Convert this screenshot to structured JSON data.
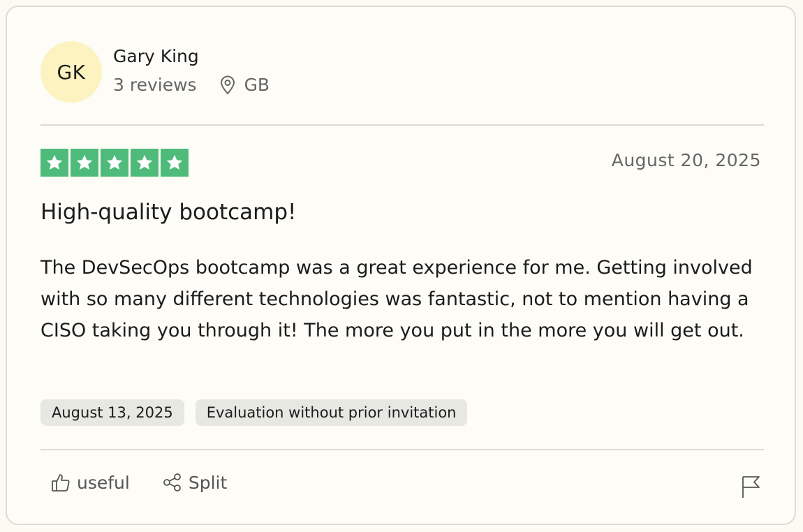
{
  "reviewer": {
    "initials": "GK",
    "name": "Gary King",
    "reviews": "3 reviews",
    "country": "GB"
  },
  "rating": {
    "stars": 5,
    "max": 5,
    "star_color": "#4fbb7b"
  },
  "review": {
    "date": "August 20, 2025",
    "title": "High-quality bootcamp!",
    "body": "The DevSecOps bootcamp was a great experience for me. Getting involved with so many different technologies was fantastic, not to mention having a CISO taking you through it! The more you put in the more you will get out."
  },
  "badges": {
    "experience_date": "August 13, 2025",
    "source": "Evaluation without prior invitation"
  },
  "actions": {
    "useful_label": "useful",
    "share_label": "Split",
    "flag_icon": "flag-icon"
  },
  "colors": {
    "avatar_bg": "#fcf3c0",
    "badge_bg": "#e8e8e3"
  }
}
